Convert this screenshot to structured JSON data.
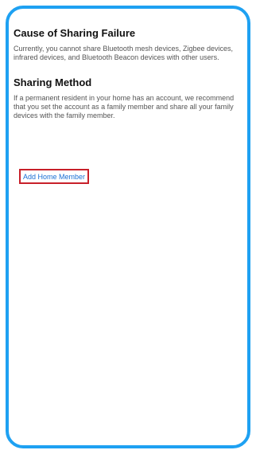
{
  "sections": [
    {
      "heading": "Cause of Sharing Failure",
      "body": "Currently, you cannot share Bluetooth mesh devices, Zigbee devices, infrared devices, and Bluetooth Beacon devices with other users."
    },
    {
      "heading": "Sharing Method",
      "body": "If a permanent resident in your home has an account, we recommend that you set the account as a family member and share all your family devices with the family member."
    }
  ],
  "actions": {
    "add_home_member": "Add Home Member"
  },
  "colors": {
    "frame": "#1ea1f2",
    "link": "#1a6fd4",
    "highlight": "#c8202a"
  }
}
